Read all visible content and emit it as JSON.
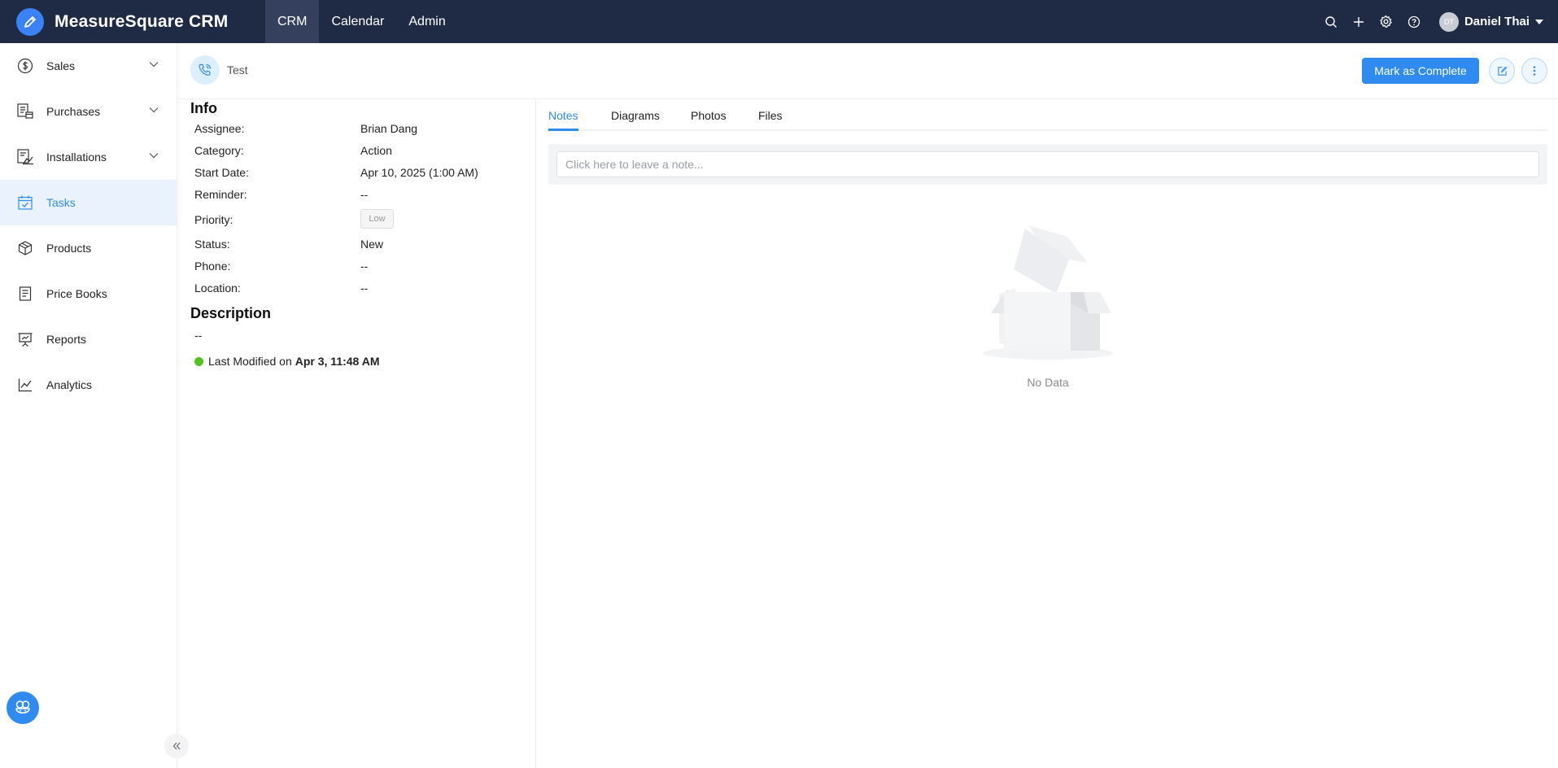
{
  "app": {
    "title": "MeasureSquare CRM"
  },
  "topnav": {
    "items": [
      "CRM",
      "Calendar",
      "Admin"
    ],
    "active": "CRM"
  },
  "user": {
    "initials": "DT",
    "name": "Daniel Thai"
  },
  "sidebar": {
    "items": [
      {
        "label": "Sales",
        "icon": "dollar-circle-icon",
        "expandable": true
      },
      {
        "label": "Purchases",
        "icon": "purchase-order-icon",
        "expandable": true
      },
      {
        "label": "Installations",
        "icon": "installation-icon",
        "expandable": true
      },
      {
        "label": "Tasks",
        "icon": "calendar-check-icon",
        "expandable": false,
        "active": true
      },
      {
        "label": "Products",
        "icon": "box-icon",
        "expandable": false
      },
      {
        "label": "Price Books",
        "icon": "document-icon",
        "expandable": false
      },
      {
        "label": "Reports",
        "icon": "presentation-icon",
        "expandable": false
      },
      {
        "label": "Analytics",
        "icon": "line-chart-icon",
        "expandable": false
      }
    ]
  },
  "task": {
    "title": "Test",
    "mark_complete_label": "Mark as Complete"
  },
  "info": {
    "title": "Info",
    "assignee_label": "Assignee:",
    "assignee": "Brian Dang",
    "category_label": "Category:",
    "category": "Action",
    "start_date_label": "Start Date:",
    "start_date": "Apr 10, 2025 (1:00 AM)",
    "reminder_label": "Reminder:",
    "reminder": "--",
    "priority_label": "Priority:",
    "priority": "Low",
    "status_label": "Status:",
    "status": "New",
    "phone_label": "Phone:",
    "phone": "--",
    "location_label": "Location:",
    "location": "--"
  },
  "description": {
    "title": "Description",
    "value": "--",
    "last_modified_prefix": "Last Modified on",
    "last_modified": "Apr 3, 11:48 AM"
  },
  "tabs": {
    "items": [
      "Notes",
      "Diagrams",
      "Photos",
      "Files"
    ],
    "active": "Notes"
  },
  "notes": {
    "placeholder": "Click here to leave a note...",
    "empty_text": "No Data"
  },
  "colors": {
    "topbar": "#1f2a44",
    "accent": "#2f8bf0",
    "status_dot": "#52c41a"
  }
}
